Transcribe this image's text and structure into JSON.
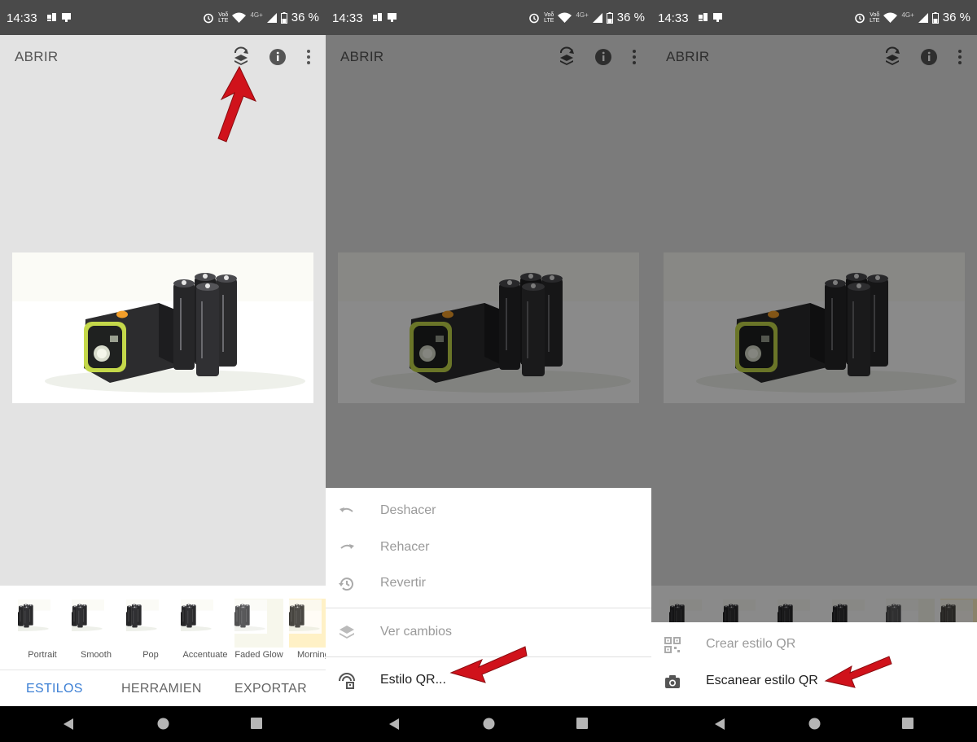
{
  "status_bar": {
    "time": "14:33",
    "network_top": "Voδ",
    "network_bottom": "LTE",
    "network_type": "4G+",
    "battery": "36 %"
  },
  "app_bar": {
    "open_label": "ABRIR",
    "icons": [
      "undo-stack-icon",
      "info-icon",
      "more-vert-icon"
    ]
  },
  "styles": [
    "Portrait",
    "Smooth",
    "Pop",
    "Accentuate",
    "Faded Glow",
    "Morning"
  ],
  "tabs": {
    "styles": "ESTILOS",
    "tools": "HERRAMIEN",
    "export": "EXPORTAR"
  },
  "menu": {
    "undo": "Deshacer",
    "redo": "Rehacer",
    "revert": "Revertir",
    "view_changes": "Ver cambios",
    "qr_style": "Estilo QR..."
  },
  "qr_menu": {
    "create": "Crear estilo QR",
    "scan": "Escanear estilo QR"
  },
  "colors": {
    "accent": "#3c7fd4",
    "status_bar": "#4a4a4a",
    "annotation_arrow": "#d0121b"
  }
}
